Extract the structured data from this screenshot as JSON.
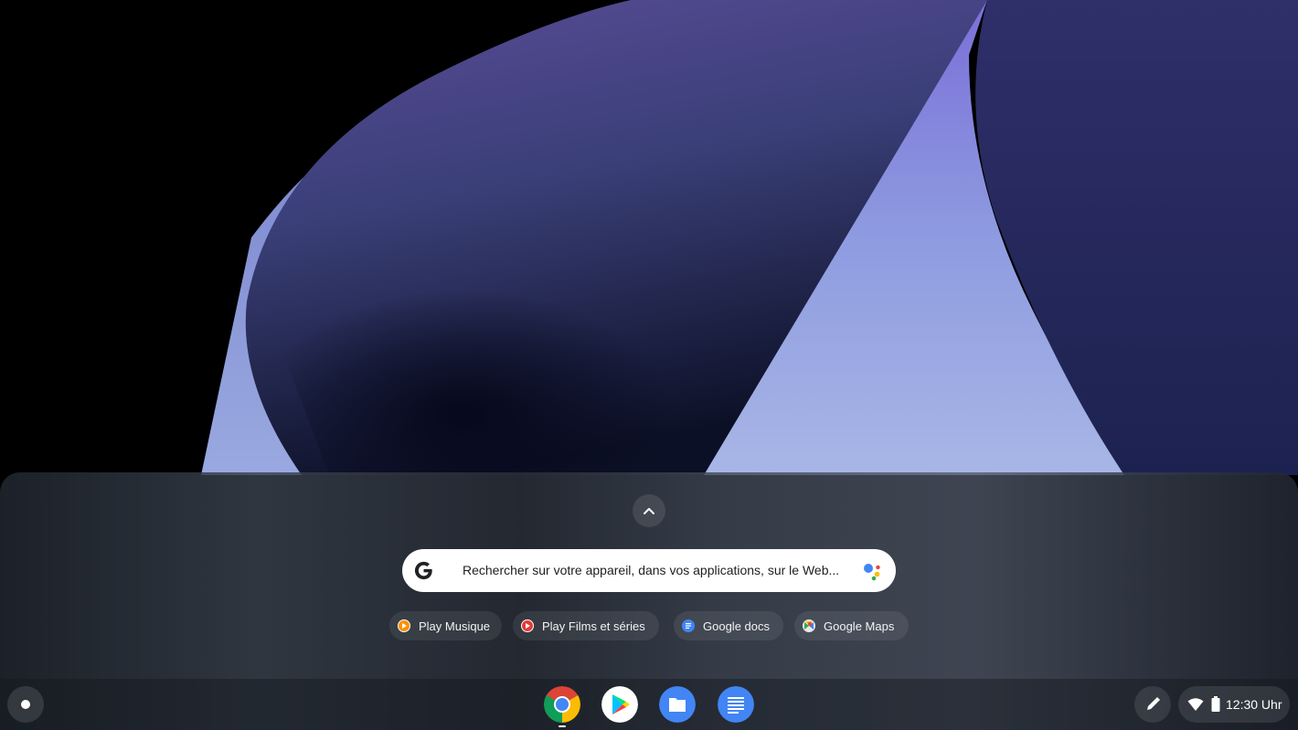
{
  "search": {
    "placeholder": "Rechercher sur votre appareil, dans vos applications, sur le Web..."
  },
  "suggestion_chips": [
    {
      "label": "Play Musique",
      "icon": "play-music-icon"
    },
    {
      "label": "Play Films et séries",
      "icon": "play-movies-icon"
    },
    {
      "label": "Google docs",
      "icon": "google-docs-icon"
    },
    {
      "label": "Google Maps",
      "icon": "google-maps-icon"
    }
  ],
  "shelf": {
    "apps": [
      {
        "name": "Chrome",
        "icon": "chrome-icon",
        "running": true
      },
      {
        "name": "Play Store",
        "icon": "play-store-icon",
        "running": false
      },
      {
        "name": "Files",
        "icon": "files-icon",
        "running": false
      },
      {
        "name": "Google Docs",
        "icon": "docs-icon",
        "running": false
      }
    ]
  },
  "status_tray": {
    "time": "12:30 Uhr",
    "wifi": "connected",
    "battery": "full"
  },
  "colors": {
    "google_blue": "#4285F4",
    "google_red": "#EA4335",
    "google_yellow": "#FBBC05",
    "google_green": "#34A853"
  }
}
